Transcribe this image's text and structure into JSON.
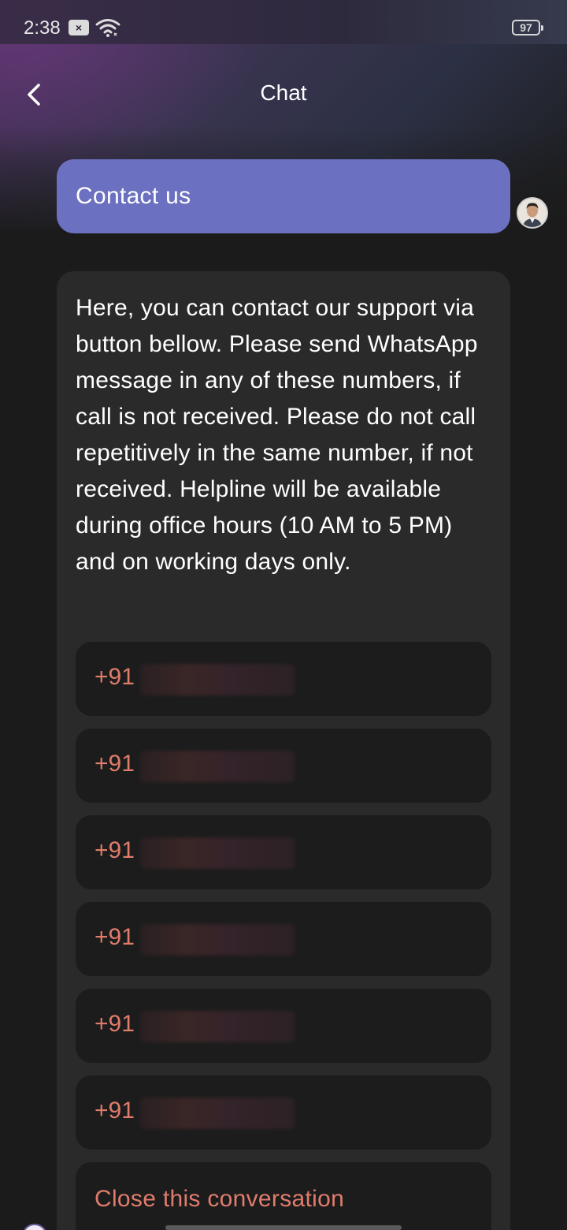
{
  "status_bar": {
    "time": "2:38",
    "notification_badge": "×",
    "battery": "97"
  },
  "app_bar": {
    "title": "Chat",
    "back_icon": "chevron-left-icon"
  },
  "chat": {
    "user_message": "Contact us",
    "bot_message": "Here, you can contact our support via button bellow. Please send WhatsApp message in any of these numbers, if call is not received. Please do not call repetitively in the same number, if not received. Helpline will be available during office hours (10 AM to 5 PM) and on working days only.",
    "phone_options": [
      {
        "prefix": "+91"
      },
      {
        "prefix": "+91"
      },
      {
        "prefix": "+91"
      },
      {
        "prefix": "+91"
      },
      {
        "prefix": "+91"
      },
      {
        "prefix": "+91"
      }
    ],
    "close_label": "Close this conversation"
  },
  "colors": {
    "user_bubble": "#6b70c0",
    "bot_bubble": "#2a2a2a",
    "option_bg": "#1c1c1c",
    "accent_text": "#e07c6c",
    "background": "#1b1b1b"
  }
}
